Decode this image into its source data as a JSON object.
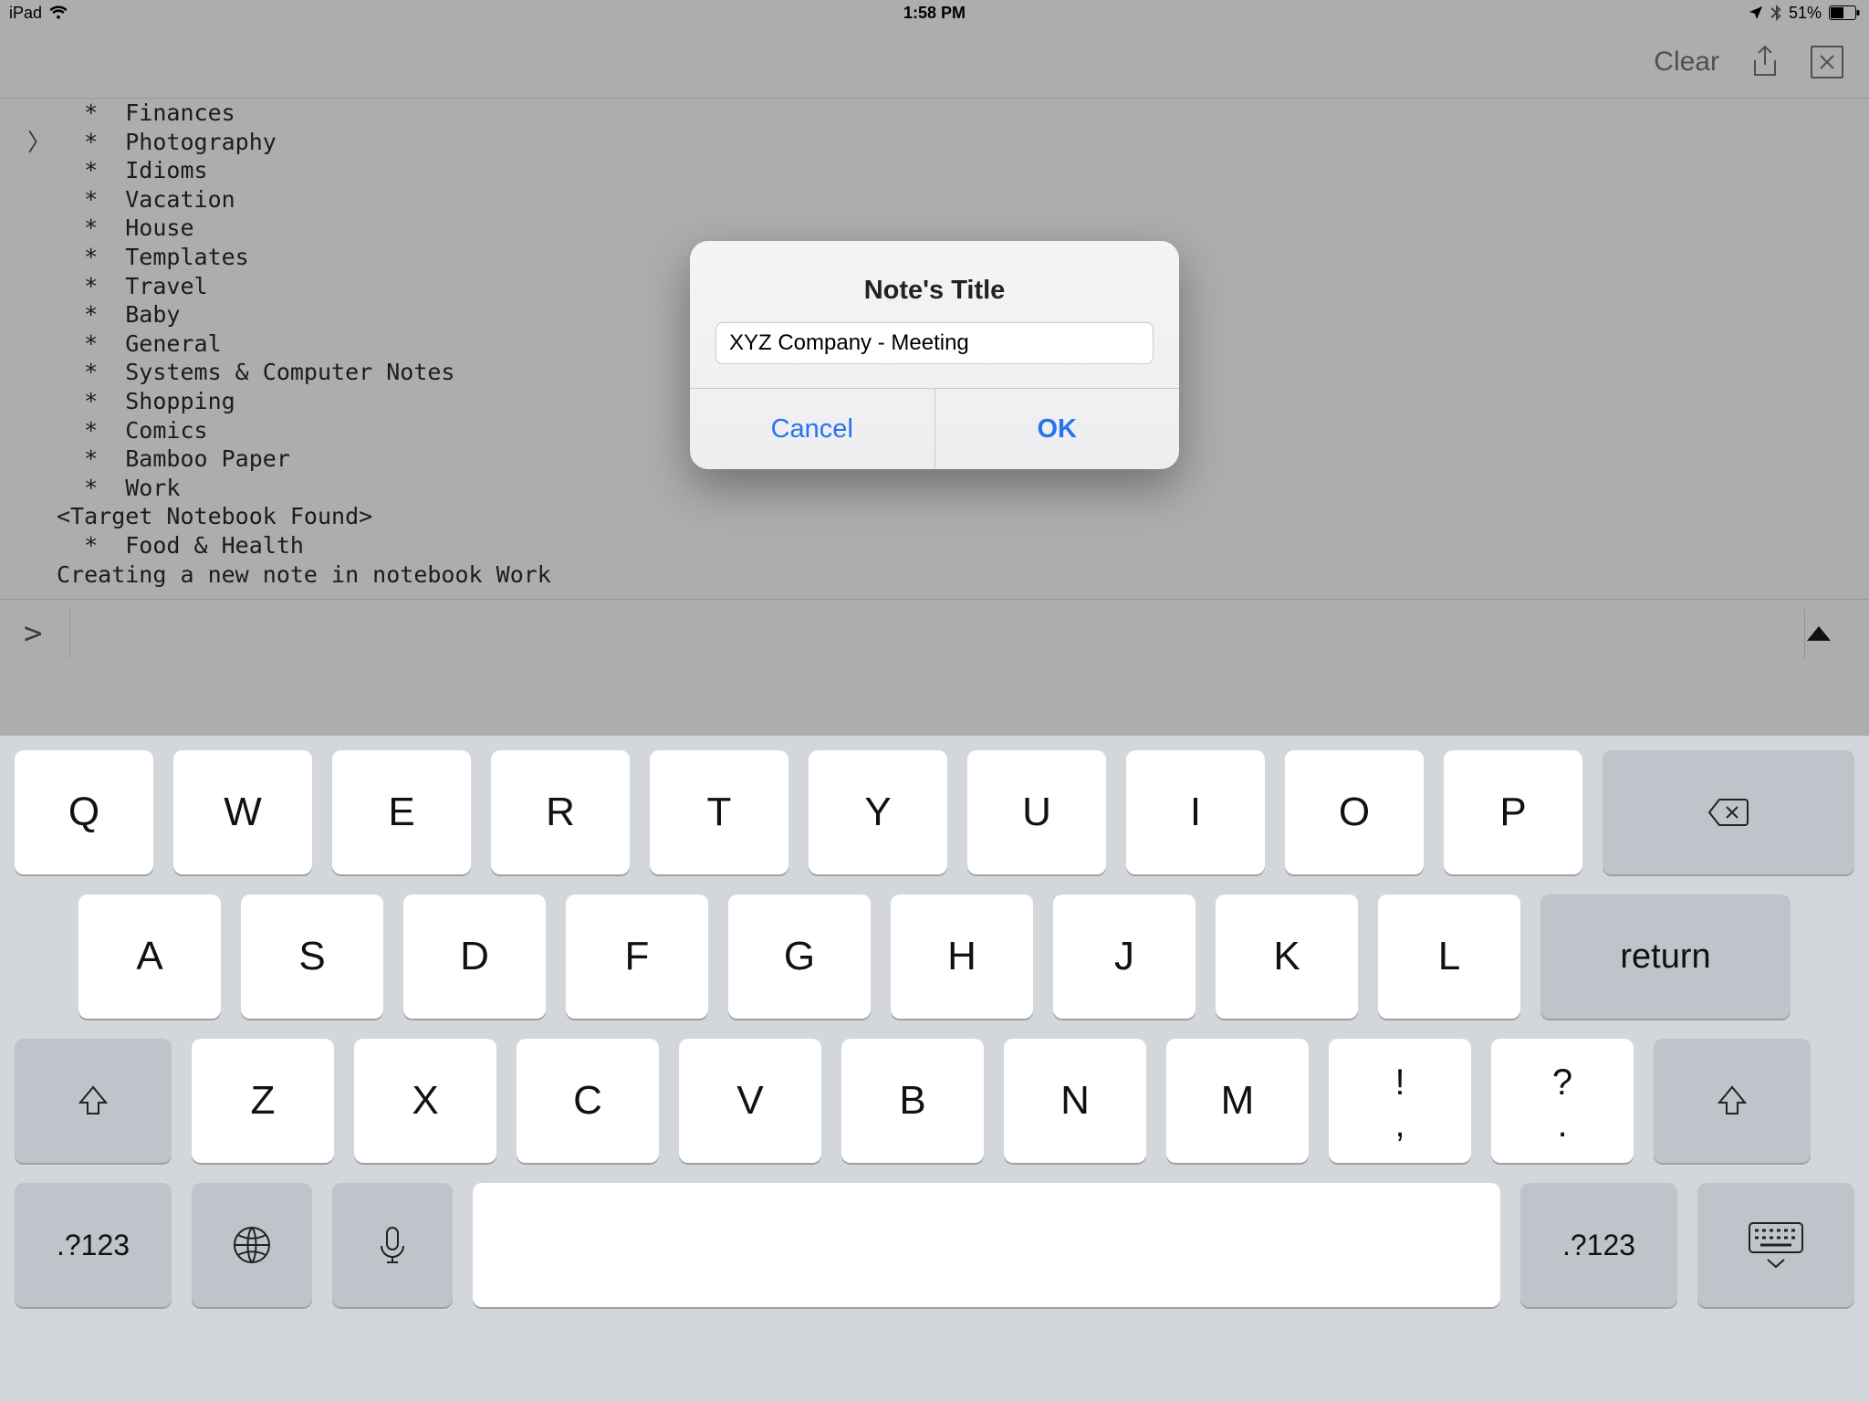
{
  "status": {
    "device": "iPad",
    "time": "1:58 PM",
    "battery_pct": "51%"
  },
  "toolbar": {
    "clear": "Clear"
  },
  "console": {
    "bullet": "*",
    "items": [
      "Finances",
      "Photography",
      "Idioms",
      "Vacation",
      "House",
      "Templates",
      "Travel",
      "Baby",
      "General",
      "Systems & Computer Notes",
      "Shopping",
      "Comics",
      "Bamboo Paper",
      "Work"
    ],
    "target_found": "<Target Notebook Found>",
    "last_item": "Food & Health",
    "creating": "Creating a new note in notebook Work"
  },
  "prompt": {
    "symbol": ">"
  },
  "modal": {
    "title": "Note's Title",
    "value": "XYZ Company - Meeting",
    "cancel": "Cancel",
    "ok": "OK"
  },
  "keyboard": {
    "row1": [
      "Q",
      "W",
      "E",
      "R",
      "T",
      "Y",
      "U",
      "I",
      "O",
      "P"
    ],
    "row2": [
      "A",
      "S",
      "D",
      "F",
      "G",
      "H",
      "J",
      "K",
      "L"
    ],
    "return": "return",
    "row3": [
      "Z",
      "X",
      "C",
      "V",
      "B",
      "N",
      "M"
    ],
    "punct1_top": "!",
    "punct1_bot": ",",
    "punct2_top": "?",
    "punct2_bot": ".",
    "numsym": ".?123"
  }
}
